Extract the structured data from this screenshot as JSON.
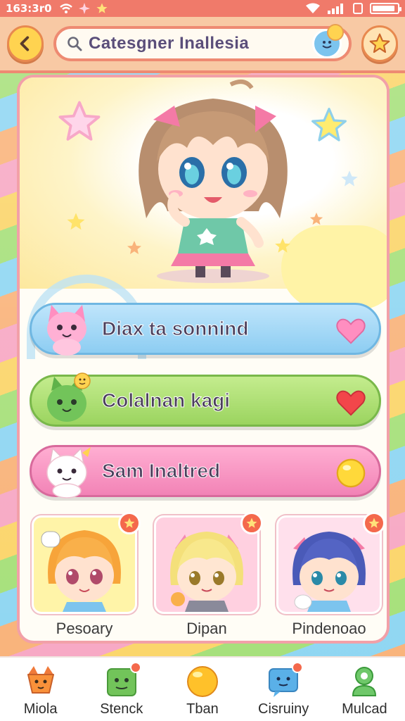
{
  "status_bar": {
    "time": "163:3r0",
    "battery_level": 0.9
  },
  "header": {
    "back_icon": "chevron-left-icon",
    "search_text": "Catesgner Inallesia",
    "favorite_icon": "star-icon"
  },
  "hero": {
    "character": "chibi-girl-waving"
  },
  "options": [
    {
      "label": "Diax ta sonnind",
      "pet": "pink-cat",
      "end_icon": "heart-icon"
    },
    {
      "label": "Colalnan kagi",
      "pet": "green-creature",
      "end_icon": "heart-icon"
    },
    {
      "label": "Sam Inaltred",
      "pet": "white-cat",
      "end_icon": "orb-icon"
    }
  ],
  "characters": [
    {
      "name": "Pesoary"
    },
    {
      "name": "Dipan"
    },
    {
      "name": "Pindenoao"
    }
  ],
  "bottom_nav": [
    {
      "label": "Miola"
    },
    {
      "label": "Stenck"
    },
    {
      "label": "Tban"
    },
    {
      "label": "Cisruiny"
    },
    {
      "label": "Mulcad"
    }
  ],
  "colors": {
    "accent": "#ee8a72",
    "blue_button": "#8dcdf2",
    "green_button": "#9bd45f",
    "pink_button": "#f283b6"
  }
}
